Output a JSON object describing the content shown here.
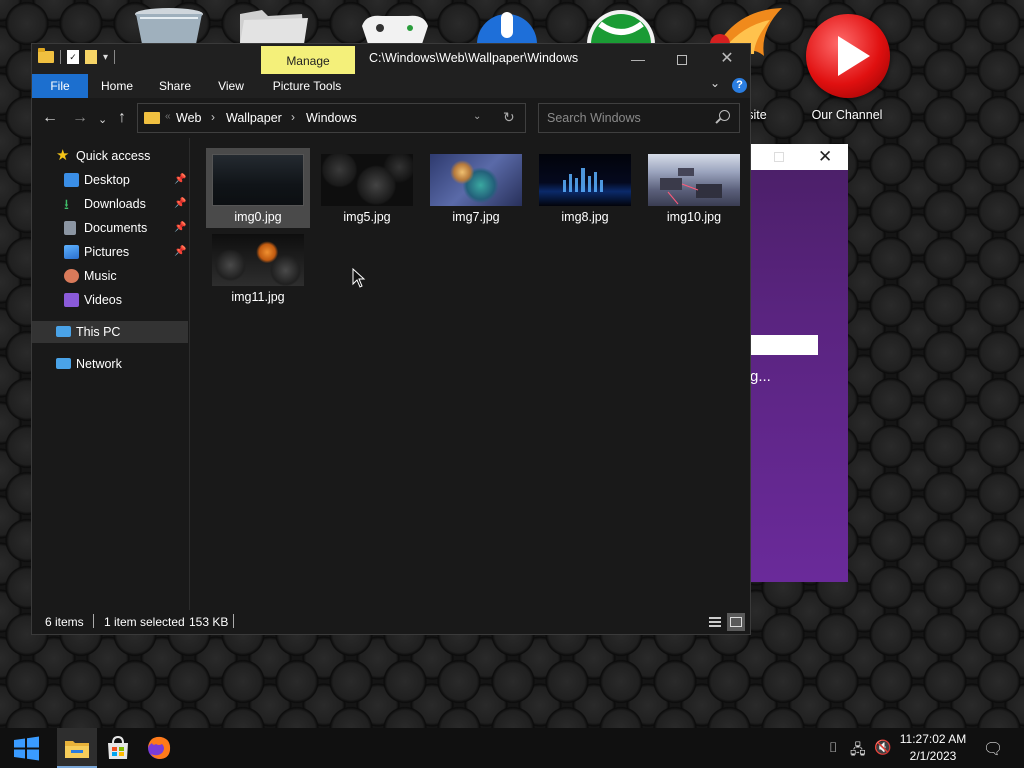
{
  "desktop": {
    "icons": [
      {
        "label": "",
        "icon": "recycle-bin-icon"
      },
      {
        "label": "",
        "icon": "folder-icon"
      },
      {
        "label": "",
        "icon": "xbox-controller-icon"
      },
      {
        "label": "",
        "icon": "app-blue-icon"
      },
      {
        "label": "",
        "icon": "xbox-icon"
      },
      {
        "label": "site",
        "icon": "browser-phoenix-icon"
      },
      {
        "label": "Our Channel",
        "icon": "youtube-play-icon"
      }
    ]
  },
  "background_window": {
    "progress_text": "g..."
  },
  "explorer": {
    "title": "C:\\Windows\\Web\\Wallpaper\\Windows",
    "contextual_tab": "Manage",
    "ribbon_tabs": {
      "file": "File",
      "home": "Home",
      "share": "Share",
      "view": "View",
      "picture_tools": "Picture Tools"
    },
    "help_glyph": "?",
    "address": {
      "crumbs": [
        "Web",
        "Wallpaper",
        "Windows"
      ]
    },
    "search": {
      "placeholder": "Search Windows",
      "value": ""
    },
    "nav_pane": {
      "quick_access": "Quick access",
      "pinned": [
        "Desktop",
        "Downloads",
        "Documents",
        "Pictures"
      ],
      "music": "Music",
      "videos": "Videos",
      "this_pc": "This PC",
      "network": "Network"
    },
    "files": [
      {
        "name": "img0.jpg",
        "selected": true
      },
      {
        "name": "img5.jpg",
        "selected": false
      },
      {
        "name": "img7.jpg",
        "selected": false
      },
      {
        "name": "img8.jpg",
        "selected": false
      },
      {
        "name": "img10.jpg",
        "selected": false
      },
      {
        "name": "img11.jpg",
        "selected": false
      }
    ],
    "status": {
      "item_count": "6 items",
      "selection": "1 item selected",
      "size": "153 KB"
    }
  },
  "taskbar": {
    "apps": [
      "start-icon",
      "file-explorer-icon",
      "microsoft-store-icon",
      "firefox-icon"
    ],
    "clock": {
      "time": "11:27:02 AM",
      "date": "2/1/2023"
    }
  },
  "colors": {
    "accent_blue": "#1c6fcf",
    "manage_tab": "#f4f07a",
    "window_bg": "#191919",
    "selected_tile": "#4a4a4a"
  }
}
